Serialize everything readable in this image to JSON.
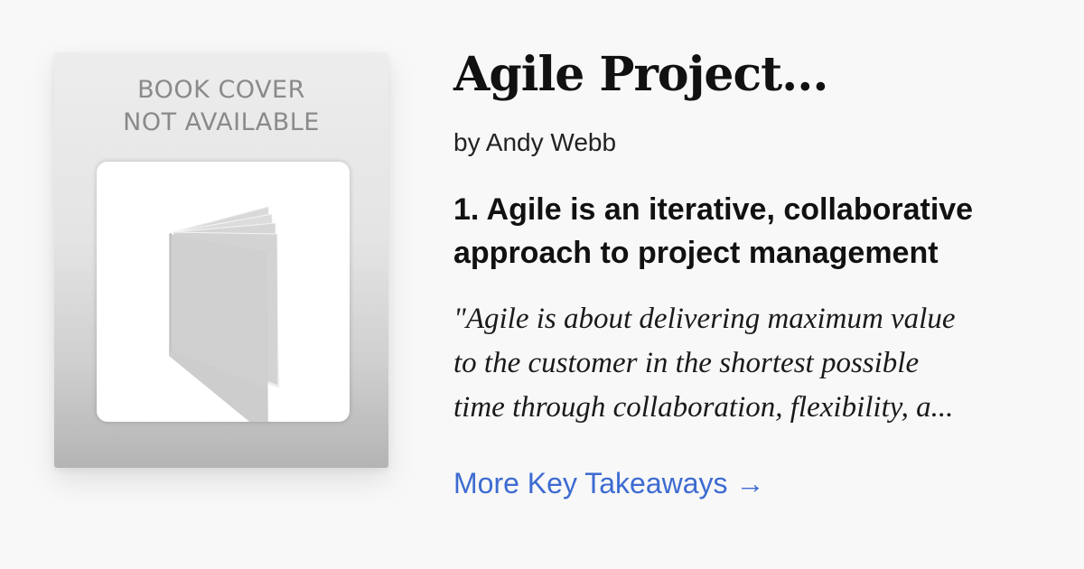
{
  "cover": {
    "placeholder_line1": "BOOK COVER",
    "placeholder_line2": "NOT AVAILABLE",
    "icon": "open-book-icon"
  },
  "book": {
    "title": "Agile Project...",
    "author": "by Andy Webb"
  },
  "takeaway": {
    "heading_line1": "1. Agile is an iterative, collaborative",
    "heading_line2": "approach to project management",
    "quote_line1": "\"Agile is about delivering maximum value",
    "quote_line2": "to the customer in the shortest possible",
    "quote_line3": "time through collaboration, flexibility, a..."
  },
  "more_link": {
    "label": "More Key Takeaways →"
  },
  "colors": {
    "background": "#f8f8f8",
    "link": "#3d6bd1",
    "cover_text": "#8a8a8a"
  }
}
